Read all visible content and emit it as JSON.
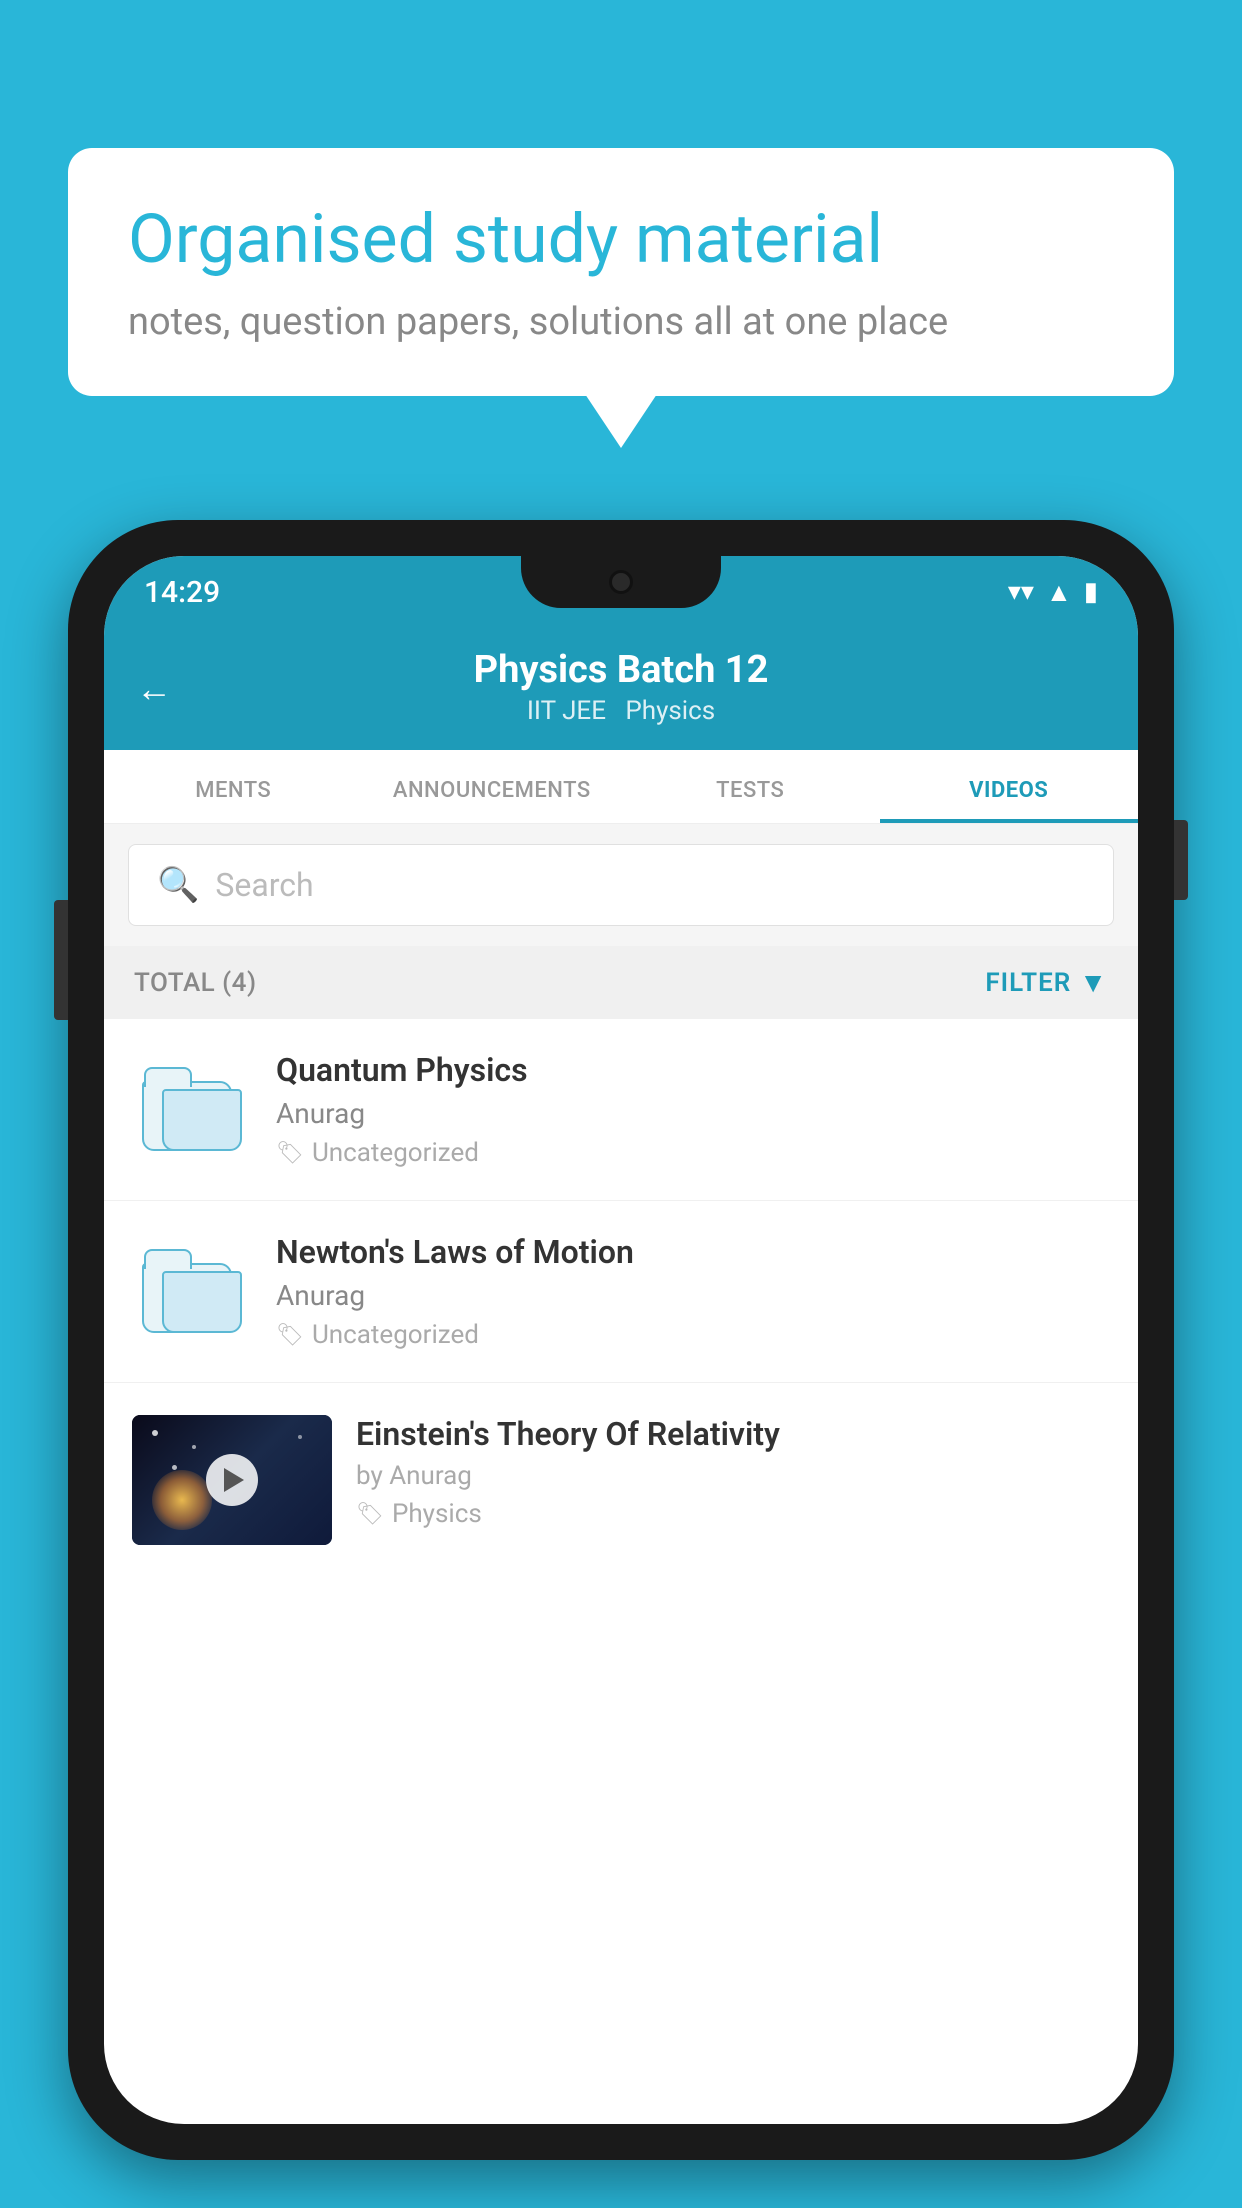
{
  "background_color": "#29b6d8",
  "speech_bubble": {
    "title": "Organised study material",
    "subtitle": "notes, question papers, solutions all at one place"
  },
  "status_bar": {
    "time": "14:29",
    "icons": [
      "wifi",
      "signal",
      "battery"
    ]
  },
  "header": {
    "title": "Physics Batch 12",
    "subtitle_tags": [
      "IIT JEE",
      "Physics"
    ],
    "back_label": "←"
  },
  "tabs": [
    {
      "label": "MENTS",
      "active": false
    },
    {
      "label": "ANNOUNCEMENTS",
      "active": false
    },
    {
      "label": "TESTS",
      "active": false
    },
    {
      "label": "VIDEOS",
      "active": true
    }
  ],
  "search": {
    "placeholder": "Search"
  },
  "filter_bar": {
    "total_label": "TOTAL (4)",
    "filter_label": "FILTER"
  },
  "video_items": [
    {
      "id": 1,
      "title": "Quantum Physics",
      "author": "Anurag",
      "tag": "Uncategorized",
      "type": "folder"
    },
    {
      "id": 2,
      "title": "Newton's Laws of Motion",
      "author": "Anurag",
      "tag": "Uncategorized",
      "type": "folder"
    },
    {
      "id": 3,
      "title": "Einstein's Theory Of Relativity",
      "author": "by Anurag",
      "tag": "Physics",
      "type": "video"
    }
  ]
}
